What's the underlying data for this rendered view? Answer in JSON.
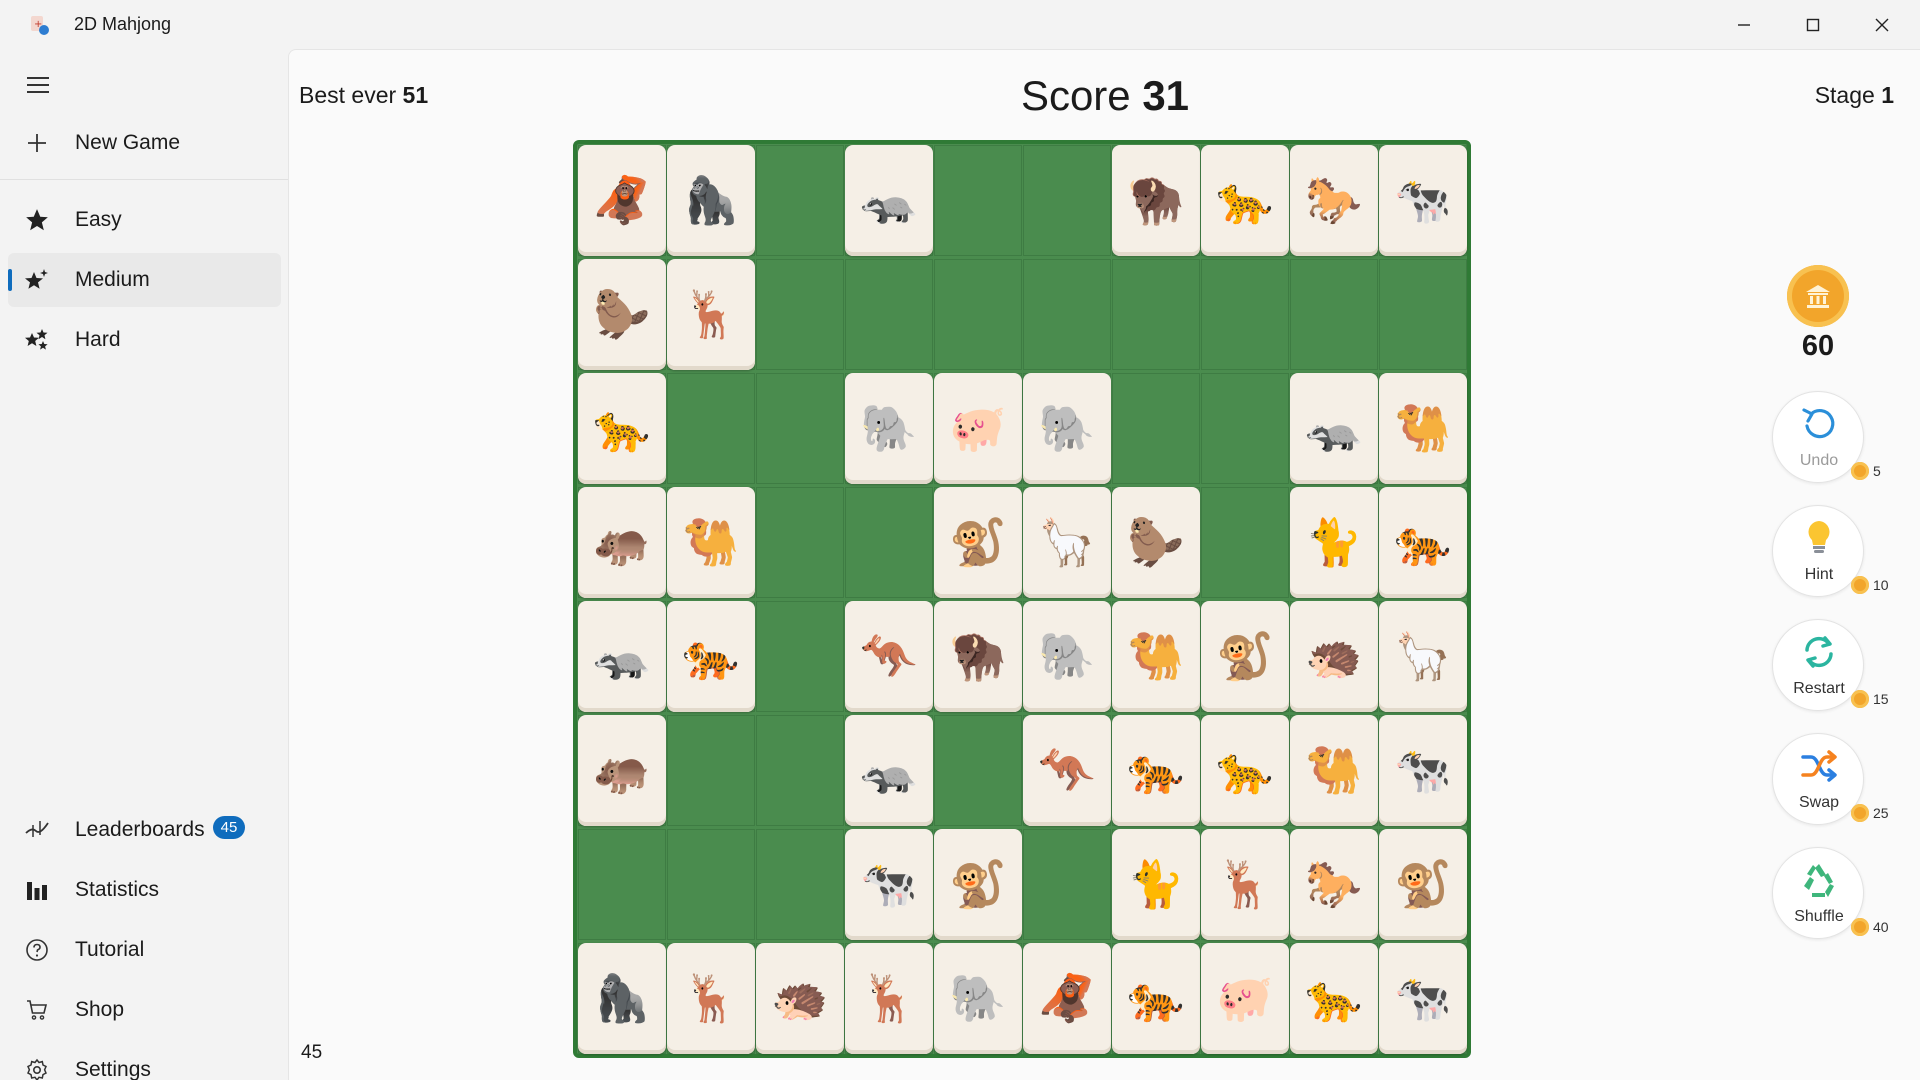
{
  "app": {
    "title": "2D Mahjong"
  },
  "sidebar": {
    "items": [
      {
        "label": "New Game",
        "icon": "plus-icon"
      },
      {
        "label": "Easy",
        "icon": "star-icon"
      },
      {
        "label": "Medium",
        "icon": "sparkle-star-icon",
        "selected": true
      },
      {
        "label": "Hard",
        "icon": "double-star-icon"
      }
    ],
    "bottom_items": [
      {
        "label": "Leaderboards",
        "icon": "leaderboard-icon",
        "badge": "45"
      },
      {
        "label": "Statistics",
        "icon": "bar-chart-icon"
      },
      {
        "label": "Tutorial",
        "icon": "question-icon"
      },
      {
        "label": "Shop",
        "icon": "cart-icon"
      },
      {
        "label": "Settings",
        "icon": "gear-icon"
      }
    ]
  },
  "game": {
    "best_label": "Best ever",
    "best_value": "51",
    "score_label": "Score",
    "score_value": "31",
    "stage_label": "Stage",
    "stage_value": "1",
    "tiles_remaining": "45",
    "coins": "60"
  },
  "controls": [
    {
      "label": "Undo",
      "cost": "5",
      "icon": "undo-icon",
      "disabled": true
    },
    {
      "label": "Hint",
      "cost": "10",
      "icon": "lightbulb-icon"
    },
    {
      "label": "Restart",
      "cost": "15",
      "icon": "restart-icon"
    },
    {
      "label": "Swap",
      "cost": "25",
      "icon": "swap-icon"
    },
    {
      "label": "Shuffle",
      "cost": "40",
      "icon": "recycle-icon"
    }
  ],
  "board": {
    "rows": 8,
    "cols": 10,
    "tiles": [
      [
        "orangutan",
        "gorilla",
        "",
        "badger",
        "",
        "",
        "bison",
        "leopard",
        "horse",
        "cow"
      ],
      [
        "beaver",
        "deer",
        "",
        "",
        "",
        "",
        "",
        "",
        "",
        ""
      ],
      [
        "leopard",
        "",
        "",
        "elephant",
        "pig",
        "elephant",
        "",
        "",
        "badger",
        "camel"
      ],
      [
        "hippo",
        "camel",
        "",
        "",
        "monkey",
        "llama",
        "beaver",
        "",
        "cat",
        "tiger"
      ],
      [
        "badger",
        "tiger",
        "",
        "kangaroo",
        "bison",
        "elephant",
        "camel",
        "monkey",
        "hedgehog",
        "llama"
      ],
      [
        "hippo",
        "",
        "",
        "badger",
        "",
        "kangaroo",
        "tiger",
        "leopard",
        "camel",
        "cow"
      ],
      [
        "",
        "",
        "",
        "cow",
        "monkey",
        "",
        "cat",
        "deer",
        "horse",
        "monkey"
      ],
      [
        "gorilla",
        "deer",
        "hedgehog",
        "deer",
        "elephant",
        "orangutan",
        "tiger",
        "pig",
        "leopard",
        "cow"
      ]
    ],
    "glyphs": {
      "orangutan": "🦧",
      "gorilla": "🦍",
      "badger": "🦡",
      "bison": "🦬",
      "leopard": "🐆",
      "horse": "🐎",
      "cow": "🐄",
      "beaver": "🦫",
      "deer": "🦌",
      "elephant": "🐘",
      "pig": "🐖",
      "camel": "🐫",
      "hippo": "🦛",
      "monkey": "🐒",
      "llama": "🦙",
      "cat": "🐈",
      "tiger": "🐅",
      "kangaroo": "🦘",
      "hedgehog": "🦔"
    }
  }
}
